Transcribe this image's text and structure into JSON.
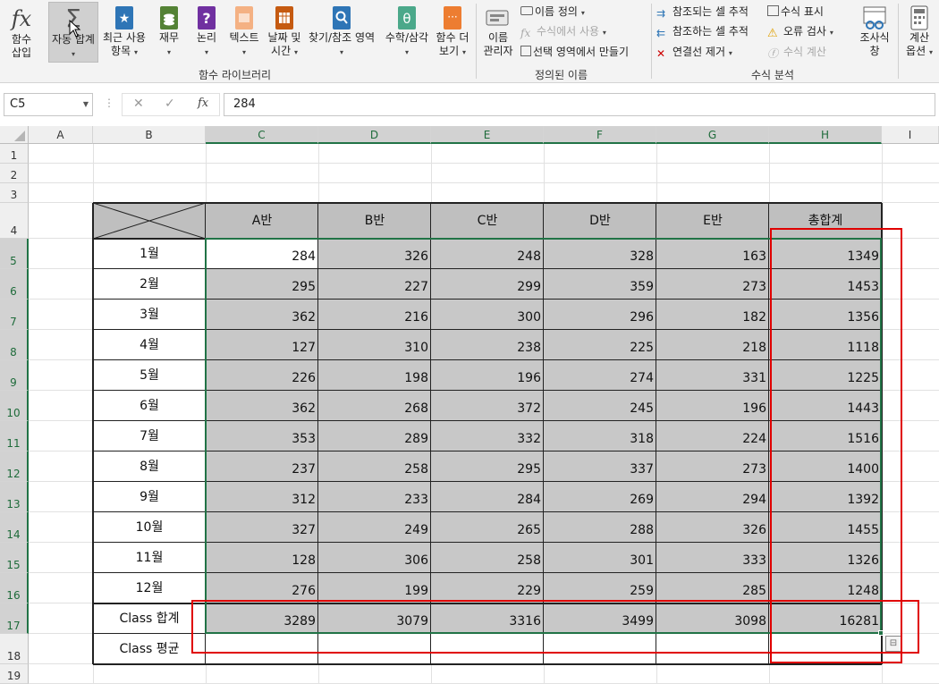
{
  "ribbon": {
    "insert_function": {
      "line1": "함수",
      "line2": "삽입",
      "icon": "fx-icon"
    },
    "buttons": [
      {
        "id": "autosum",
        "line1": "자동 합계",
        "icon": "sigma-icon",
        "color": "#555555"
      },
      {
        "id": "recent",
        "line1": "최근 사용",
        "line2": "항목",
        "icon": "star-book-icon",
        "color": "#2e75b6"
      },
      {
        "id": "financial",
        "line1": "재무",
        "icon": "financial-book-icon",
        "color": "#548235"
      },
      {
        "id": "logical",
        "line1": "논리",
        "icon": "question-book-icon",
        "color": "#7030a0"
      },
      {
        "id": "text",
        "line1": "텍스트",
        "icon": "text-book-icon",
        "color": "#f4b183"
      },
      {
        "id": "datetime",
        "line1": "날짜 및",
        "line2": "시간",
        "icon": "calendar-book-icon",
        "color": "#c55a11"
      },
      {
        "id": "lookup",
        "line1": "찾기/참조 영역",
        "icon": "lookup-book-icon",
        "color": "#2e75b6"
      },
      {
        "id": "math",
        "line1": "수학/삼각",
        "icon": "theta-book-icon",
        "color": "#4ba88a"
      },
      {
        "id": "more",
        "line1": "함수 더",
        "line2": "보기",
        "icon": "more-book-icon",
        "color": "#ed7d31"
      }
    ],
    "group_function_library": "함수 라이브러리",
    "name_manager": {
      "line1": "이름",
      "line2": "관리자"
    },
    "define_name": "이름 정의",
    "use_in_formula": "수식에서 사용",
    "create_from_selection": "선택 영역에서 만들기",
    "group_defined_names": "정의된 이름",
    "trace_precedents": "참조되는 셀 추적",
    "trace_dependents": "참조하는 셀 추적",
    "remove_arrows": "연결선 제거",
    "show_formulas": "수식 표시",
    "error_checking": "오류 검사",
    "evaluate_formula": "수식 계산",
    "group_formula_auditing": "수식 분석",
    "watch_window": {
      "line1": "조사식",
      "line2": "창"
    },
    "calc_options": {
      "line1": "계산",
      "line2": "옵션"
    }
  },
  "formula_bar": {
    "name_box": "C5",
    "value": "284",
    "fx_label": "fx"
  },
  "columns": [
    "A",
    "B",
    "C",
    "D",
    "E",
    "F",
    "G",
    "H",
    "I"
  ],
  "rows": [
    "1",
    "2",
    "3",
    "4",
    "5",
    "6",
    "7",
    "8",
    "9",
    "10",
    "11",
    "12",
    "13",
    "14",
    "15",
    "16",
    "17",
    "18",
    "19"
  ],
  "table": {
    "headers": [
      "A반",
      "B반",
      "C반",
      "D반",
      "E반",
      "총합계"
    ],
    "row_labels": [
      "1월",
      "2월",
      "3월",
      "4월",
      "5월",
      "6월",
      "7월",
      "8월",
      "9월",
      "10월",
      "11월",
      "12월",
      "Class 합계",
      "Class 평균"
    ],
    "data": [
      [
        "284",
        "326",
        "248",
        "328",
        "163",
        "1349"
      ],
      [
        "295",
        "227",
        "299",
        "359",
        "273",
        "1453"
      ],
      [
        "362",
        "216",
        "300",
        "296",
        "182",
        "1356"
      ],
      [
        "127",
        "310",
        "238",
        "225",
        "218",
        "1118"
      ],
      [
        "226",
        "198",
        "196",
        "274",
        "331",
        "1225"
      ],
      [
        "362",
        "268",
        "372",
        "245",
        "196",
        "1443"
      ],
      [
        "353",
        "289",
        "332",
        "318",
        "224",
        "1516"
      ],
      [
        "237",
        "258",
        "295",
        "337",
        "273",
        "1400"
      ],
      [
        "312",
        "233",
        "284",
        "269",
        "294",
        "1392"
      ],
      [
        "327",
        "249",
        "265",
        "288",
        "326",
        "1455"
      ],
      [
        "128",
        "306",
        "258",
        "301",
        "333",
        "1326"
      ],
      [
        "276",
        "199",
        "229",
        "259",
        "285",
        "1248"
      ],
      [
        "3289",
        "3079",
        "3316",
        "3499",
        "3098",
        "16281"
      ],
      [
        "",
        "",
        "",
        "",
        "",
        ""
      ]
    ]
  },
  "colors": {
    "selection": "#c8c8c8",
    "header_fill": "#bfbfbf",
    "excel_green": "#217346",
    "highlight_red": "#e00000"
  }
}
